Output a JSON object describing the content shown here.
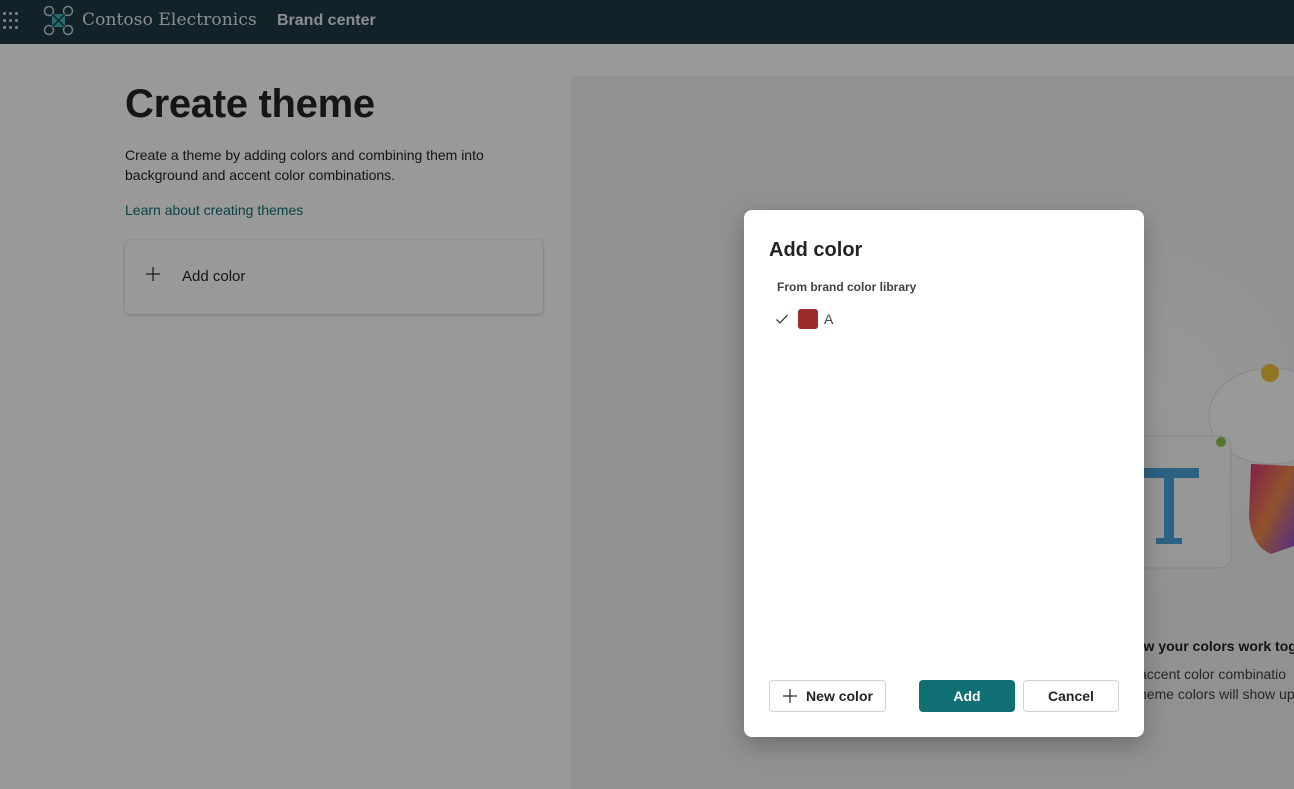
{
  "header": {
    "org_name": "Contoso Electronics",
    "app_name": "Brand center"
  },
  "page": {
    "title": "Create theme",
    "description": "Create a theme by adding colors and combining them into background and accent color combinations.",
    "learn_link": "Learn about creating themes",
    "add_color_card": "Add color"
  },
  "preview": {
    "title": "ow your colors work tog",
    "line1": "accent color combinatio",
    "line2": "heme colors will show up"
  },
  "dialog": {
    "title": "Add color",
    "section_label": "From brand color library",
    "colors": [
      {
        "name": "A",
        "hex": "#9e2a2b",
        "selected": true
      }
    ],
    "new_color_button": "New color",
    "add_button": "Add",
    "cancel_button": "Cancel"
  },
  "colors": {
    "accent": "#0f6f73",
    "topbar": "#1f3a45"
  }
}
